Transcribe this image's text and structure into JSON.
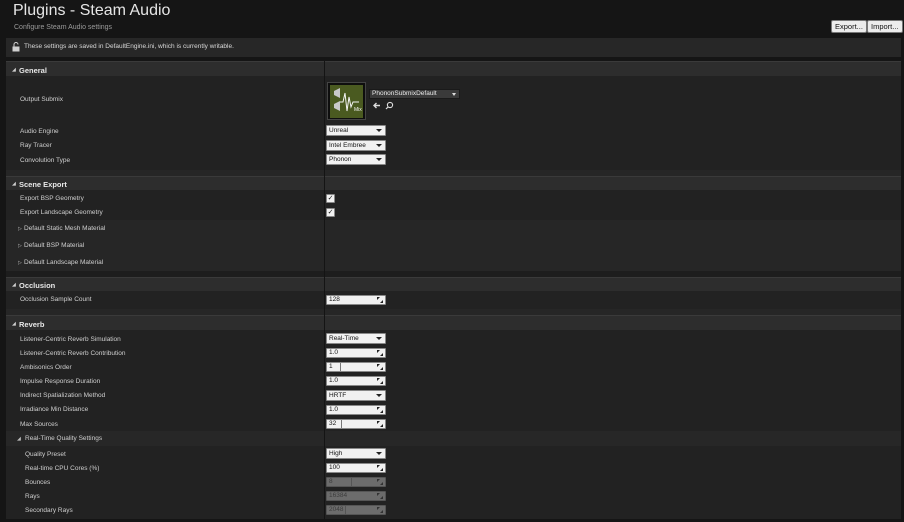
{
  "header": {
    "title": "Plugins - Steam Audio",
    "subtitle": "Configure Steam Audio settings",
    "export_label": "Export...",
    "import_label": "Import..."
  },
  "notice": {
    "text": "These settings are saved in DefaultEngine.ini, which is currently writable."
  },
  "sections": {
    "general": "General",
    "scene_export": "Scene Export",
    "occlusion": "Occlusion",
    "reverb": "Reverb",
    "realtime_quality": "Real-Time Quality Settings"
  },
  "general": {
    "output_submix_label": "Output Submix",
    "output_submix_value": "PhononSubmixDefault",
    "audio_engine_label": "Audio Engine",
    "audio_engine_value": "Unreal",
    "ray_tracer_label": "Ray Tracer",
    "ray_tracer_value": "Intel Embree",
    "convolution_type_label": "Convolution Type",
    "convolution_type_value": "Phonon"
  },
  "scene_export": {
    "bsp_label": "Export BSP Geometry",
    "bsp_checked": "✓",
    "landscape_label": "Export Landscape Geometry",
    "landscape_checked": "✓",
    "static_mesh_label": "Default Static Mesh Material",
    "bsp_material_label": "Default BSP Material",
    "landscape_material_label": "Default Landscape Material"
  },
  "occlusion": {
    "sample_count_label": "Occlusion Sample Count",
    "sample_count_value": "128"
  },
  "reverb": {
    "simulation_label": "Listener-Centric Reverb Simulation",
    "simulation_value": "Real-Time",
    "contribution_label": "Listener-Centric Reverb Contribution",
    "contribution_value": "1.0",
    "ambisonics_label": "Ambisonics Order",
    "ambisonics_value": "1",
    "impulse_label": "Impulse Response Duration",
    "impulse_value": "1.0",
    "spatialization_label": "Indirect Spatialization Method",
    "spatialization_value": "HRTF",
    "irradiance_label": "Irradiance Min Distance",
    "irradiance_value": "1.0",
    "max_sources_label": "Max Sources",
    "max_sources_value": "32"
  },
  "realtime": {
    "quality_preset_label": "Quality Preset",
    "quality_preset_value": "High",
    "cpu_cores_label": "Real-time CPU Cores (%)",
    "cpu_cores_value": "100",
    "bounces_label": "Bounces",
    "bounces_value": "8",
    "rays_label": "Rays",
    "rays_value": "16384",
    "secondary_rays_label": "Secondary Rays",
    "secondary_rays_value": "2048"
  },
  "colors": {
    "background": "#151515",
    "panel": "#222222",
    "section_header": "#2d2d2d",
    "thumbnail": "#4a5a20"
  }
}
